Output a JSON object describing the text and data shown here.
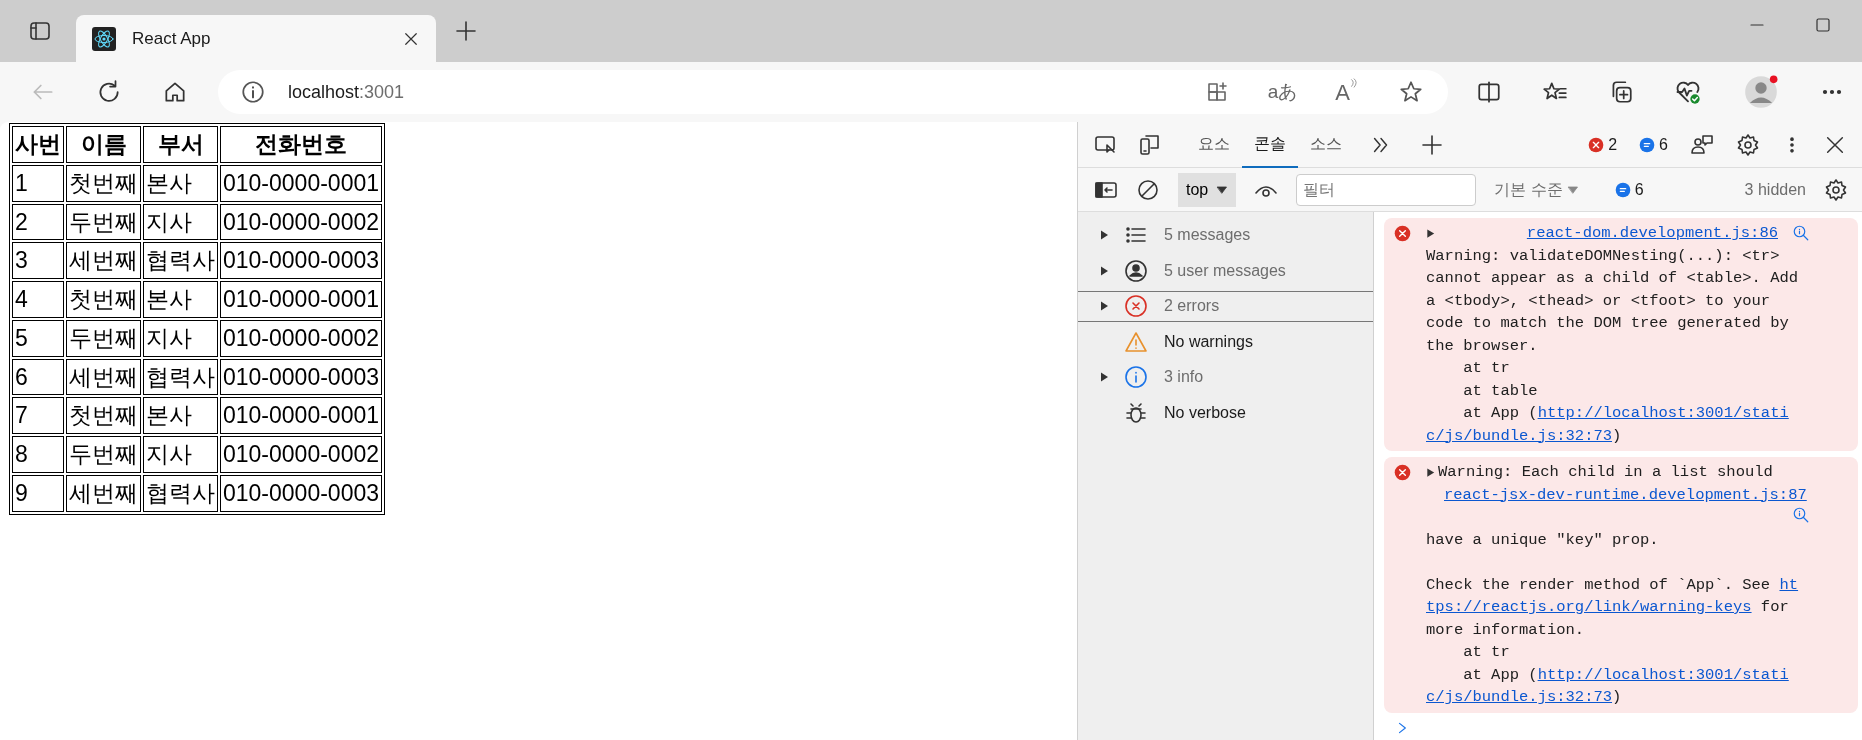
{
  "browser": {
    "tab": {
      "title": "React App"
    },
    "address": {
      "host": "localhost",
      "port": ":3001"
    },
    "translate_glyph": "aあ",
    "read_aloud_glyph": "A"
  },
  "page": {
    "table": {
      "columns": [
        "사번",
        "이름",
        "부서",
        "전화번호"
      ],
      "rows": [
        [
          "1",
          "첫번째",
          "본사",
          "010-0000-0001"
        ],
        [
          "2",
          "두번째",
          "지사",
          "010-0000-0002"
        ],
        [
          "3",
          "세번째",
          "협력사",
          "010-0000-0003"
        ],
        [
          "4",
          "첫번째",
          "본사",
          "010-0000-0001"
        ],
        [
          "5",
          "두번째",
          "지사",
          "010-0000-0002"
        ],
        [
          "6",
          "세번째",
          "협력사",
          "010-0000-0003"
        ],
        [
          "7",
          "첫번째",
          "본사",
          "010-0000-0001"
        ],
        [
          "8",
          "두번째",
          "지사",
          "010-0000-0002"
        ],
        [
          "9",
          "세번째",
          "협력사",
          "010-0000-0003"
        ]
      ]
    }
  },
  "devtools": {
    "tabs": [
      {
        "label": "요소",
        "selected": false
      },
      {
        "label": "콘솔",
        "selected": true
      },
      {
        "label": "소스",
        "selected": false
      }
    ],
    "error_count": "2",
    "message_count": "6",
    "context": "top",
    "filter": {
      "placeholder": "필터"
    },
    "level_menu": "기본 수준",
    "filter_message_count": "6",
    "hidden_count": "3 hidden",
    "sidebar": [
      {
        "kind": "messages",
        "label": "5 messages",
        "expandable": true,
        "selected": false
      },
      {
        "kind": "user",
        "label": "5 user messages",
        "expandable": true,
        "selected": false
      },
      {
        "kind": "errors",
        "label": "2 errors",
        "expandable": true,
        "selected": true
      },
      {
        "kind": "warnings",
        "label": "No warnings",
        "expandable": false,
        "selected": false
      },
      {
        "kind": "info",
        "label": "3 info",
        "expandable": true,
        "selected": false
      },
      {
        "kind": "verbose",
        "label": "No verbose",
        "expandable": false,
        "selected": false
      }
    ],
    "messages": [
      {
        "kind": "source_top",
        "source": "react-dom.development.js:86",
        "paragraphs": [
          [
            [
              "Warning: validateDOMNesting(...): <tr>"
            ],
            [
              "cannot appear as a child of <table>. Add"
            ],
            [
              "a <tbody>, <thead> or <tfoot> to your"
            ],
            [
              "code to match the DOM tree generated by"
            ],
            [
              "the browser."
            ],
            [
              "    at tr"
            ],
            [
              "    at table"
            ],
            [
              "    at App (",
              {
                "link": "http://localhost:3001/stati"
              }
            ],
            [
              {
                "link": "c/js/bundle.js:32:73"
              },
              ")"
            ]
          ]
        ]
      },
      {
        "kind": "text_top",
        "source": "react-jsx-dev-runtime.development.js:87",
        "paragraphs": [
          [
            [
              "Warning: Each child in a list should"
            ],
            [
              "have a unique \"key\" prop."
            ]
          ],
          [
            [
              "Check the render method of `App`. See ",
              {
                "link": "ht"
              }
            ],
            [
              {
                "link": "tps://reactjs.org/link/warning-keys"
              },
              " for"
            ],
            [
              "more information."
            ],
            [
              "    at tr"
            ],
            [
              "    at App (",
              {
                "link": "http://localhost:3001/stati"
              }
            ],
            [
              {
                "link": "c/js/bundle.js:32:73"
              },
              ")"
            ]
          ]
        ]
      }
    ]
  }
}
